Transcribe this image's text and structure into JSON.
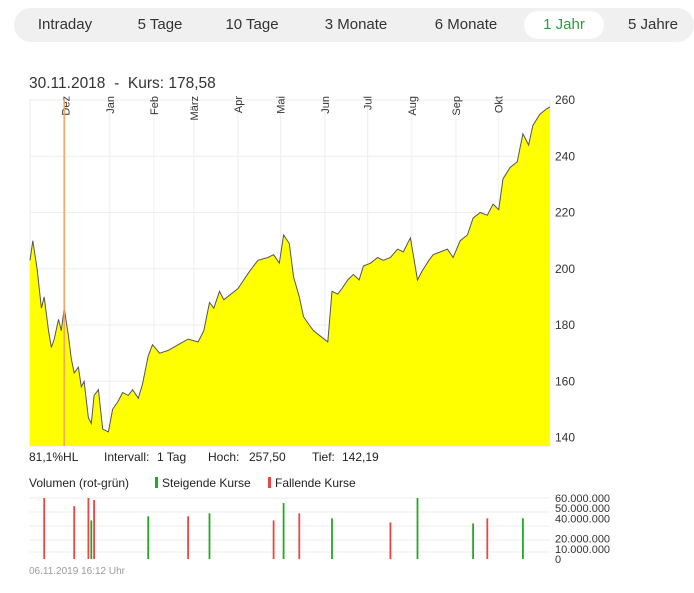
{
  "tabs": [
    {
      "label": "Intraday",
      "active": false
    },
    {
      "label": "5 Tage",
      "active": false
    },
    {
      "label": "10 Tage",
      "active": false
    },
    {
      "label": "3 Monate",
      "active": false
    },
    {
      "label": "6 Monate",
      "active": false
    },
    {
      "label": "1 Jahr",
      "active": true
    },
    {
      "label": "5 Jahre",
      "active": false
    }
  ],
  "header": {
    "date": "30.11.2018",
    "separator": "-",
    "kurs_label": "Kurs:",
    "kurs_value": "178,58"
  },
  "stats": {
    "hl_pct": "81,1%HL",
    "interval_label": "Intervall:",
    "interval_value": "1 Tag",
    "high_label": "Hoch:",
    "high_value": "257,50",
    "low_label": "Tief:",
    "low_value": "142,19"
  },
  "volume_legend": {
    "title": "Volumen (rot-grün)",
    "up_label": "Steigende Kurse",
    "down_label": "Fallende Kurse"
  },
  "footer_timestamp": "06.11.2019 16:12 Uhr",
  "colors": {
    "area_fill": "#ffff00",
    "price_line": "#555555",
    "marker": "#f4a460",
    "up": "#22aa22",
    "down": "#ee4444",
    "active_tab": "#2a9d3a"
  },
  "chart_data": [
    {
      "type": "area",
      "x_range": [
        "2018-11-06",
        "2019-11-06"
      ],
      "x_ticks": [
        {
          "date": "2018-12-01",
          "label": "Dez"
        },
        {
          "date": "2019-01-01",
          "label": "Jan"
        },
        {
          "date": "2019-02-01",
          "label": "Feb"
        },
        {
          "date": "2019-03-01",
          "label": "März"
        },
        {
          "date": "2019-04-01",
          "label": "Apr"
        },
        {
          "date": "2019-05-01",
          "label": "Mai"
        },
        {
          "date": "2019-06-01",
          "label": "Jun"
        },
        {
          "date": "2019-07-01",
          "label": "Jul"
        },
        {
          "date": "2019-08-01",
          "label": "Aug"
        },
        {
          "date": "2019-09-01",
          "label": "Sep"
        },
        {
          "date": "2019-10-01",
          "label": "Okt"
        }
      ],
      "ylim": [
        137,
        260
      ],
      "y_ticks": [
        140,
        160,
        180,
        200,
        220,
        240,
        260
      ],
      "grid": true,
      "marker_date": "2018-11-30",
      "series": [
        {
          "values": [
            [
              "2018-11-06",
              203
            ],
            [
              "2018-11-08",
              210
            ],
            [
              "2018-11-11",
              200
            ],
            [
              "2018-11-14",
              186
            ],
            [
              "2018-11-16",
              190
            ],
            [
              "2018-11-19",
              178
            ],
            [
              "2018-11-21",
              172
            ],
            [
              "2018-11-23",
              175
            ],
            [
              "2018-11-26",
              182
            ],
            [
              "2018-11-28",
              178
            ],
            [
              "2018-11-30",
              186
            ],
            [
              "2018-12-03",
              176
            ],
            [
              "2018-12-05",
              168
            ],
            [
              "2018-12-07",
              163
            ],
            [
              "2018-12-10",
              165
            ],
            [
              "2018-12-12",
              158
            ],
            [
              "2018-12-14",
              160
            ],
            [
              "2018-12-17",
              147
            ],
            [
              "2018-12-19",
              145
            ],
            [
              "2018-12-21",
              155
            ],
            [
              "2018-12-24",
              157
            ],
            [
              "2018-12-27",
              143
            ],
            [
              "2018-12-31",
              142
            ],
            [
              "2019-01-03",
              150
            ],
            [
              "2019-01-07",
              153
            ],
            [
              "2019-01-10",
              156
            ],
            [
              "2019-01-14",
              155
            ],
            [
              "2019-01-17",
              157
            ],
            [
              "2019-01-21",
              154
            ],
            [
              "2019-01-24",
              159
            ],
            [
              "2019-01-28",
              169
            ],
            [
              "2019-01-31",
              173
            ],
            [
              "2019-02-05",
              170
            ],
            [
              "2019-02-11",
              171
            ],
            [
              "2019-02-18",
              173
            ],
            [
              "2019-02-25",
              175
            ],
            [
              "2019-03-04",
              174
            ],
            [
              "2019-03-08",
              178
            ],
            [
              "2019-03-12",
              188
            ],
            [
              "2019-03-15",
              186
            ],
            [
              "2019-03-19",
              192
            ],
            [
              "2019-03-22",
              189
            ],
            [
              "2019-03-27",
              191
            ],
            [
              "2019-04-01",
              193
            ],
            [
              "2019-04-05",
              196
            ],
            [
              "2019-04-09",
              199
            ],
            [
              "2019-04-15",
              203
            ],
            [
              "2019-04-22",
              204
            ],
            [
              "2019-04-26",
              205
            ],
            [
              "2019-04-30",
              202
            ],
            [
              "2019-05-03",
              212
            ],
            [
              "2019-05-07",
              209
            ],
            [
              "2019-05-10",
              197
            ],
            [
              "2019-05-14",
              190
            ],
            [
              "2019-05-17",
              183
            ],
            [
              "2019-05-21",
              180
            ],
            [
              "2019-05-24",
              178
            ],
            [
              "2019-05-29",
              176
            ],
            [
              "2019-06-03",
              174
            ],
            [
              "2019-06-06",
              192
            ],
            [
              "2019-06-10",
              191
            ],
            [
              "2019-06-13",
              193
            ],
            [
              "2019-06-17",
              196
            ],
            [
              "2019-06-21",
              198
            ],
            [
              "2019-06-25",
              196
            ],
            [
              "2019-06-28",
              201
            ],
            [
              "2019-07-03",
              202
            ],
            [
              "2019-07-08",
              204
            ],
            [
              "2019-07-12",
              203
            ],
            [
              "2019-07-17",
              204
            ],
            [
              "2019-07-22",
              207
            ],
            [
              "2019-07-26",
              206
            ],
            [
              "2019-07-31",
              211
            ],
            [
              "2019-08-05",
              196
            ],
            [
              "2019-08-08",
              199
            ],
            [
              "2019-08-13",
              203
            ],
            [
              "2019-08-16",
              205
            ],
            [
              "2019-08-21",
              206
            ],
            [
              "2019-08-26",
              207
            ],
            [
              "2019-08-30",
              204
            ],
            [
              "2019-09-04",
              210
            ],
            [
              "2019-09-09",
              212
            ],
            [
              "2019-09-13",
              218
            ],
            [
              "2019-09-18",
              220
            ],
            [
              "2019-09-23",
              219
            ],
            [
              "2019-09-27",
              223
            ],
            [
              "2019-10-01",
              221
            ],
            [
              "2019-10-04",
              232
            ],
            [
              "2019-10-09",
              236
            ],
            [
              "2019-10-14",
              238
            ],
            [
              "2019-10-18",
              248
            ],
            [
              "2019-10-22",
              244
            ],
            [
              "2019-10-25",
              251
            ],
            [
              "2019-10-30",
              255
            ],
            [
              "2019-11-04",
              257
            ],
            [
              "2019-11-06",
              257.5
            ]
          ]
        }
      ]
    },
    {
      "type": "bar",
      "x_range": [
        "2018-11-06",
        "2019-11-06"
      ],
      "ylim": [
        0,
        60000000
      ],
      "y_tick_labels": [
        "60.000.000",
        "50.000.000",
        "40.000.000",
        "20.000.000",
        "10.000.000",
        "0"
      ],
      "y_tick_values": [
        60000000,
        50000000,
        40000000,
        20000000,
        10000000,
        0
      ],
      "series": [
        {
          "name": "Steigende Kurse",
          "x": [
            "2018-12-19",
            "2019-01-28",
            "2019-03-12",
            "2019-05-03",
            "2019-06-06",
            "2019-08-05",
            "2019-09-13",
            "2019-10-18"
          ],
          "values": [
            38000000,
            42000000,
            45000000,
            55000000,
            40000000,
            62000000,
            35000000,
            40000000
          ]
        },
        {
          "name": "Fallende Kurse",
          "x": [
            "2018-11-16",
            "2018-12-07",
            "2018-12-17",
            "2018-12-21",
            "2019-02-25",
            "2019-04-26",
            "2019-05-14",
            "2019-07-17",
            "2019-09-23"
          ],
          "values": [
            60000000,
            52000000,
            62000000,
            58000000,
            42000000,
            38000000,
            45000000,
            36000000,
            40000000
          ]
        }
      ]
    }
  ]
}
